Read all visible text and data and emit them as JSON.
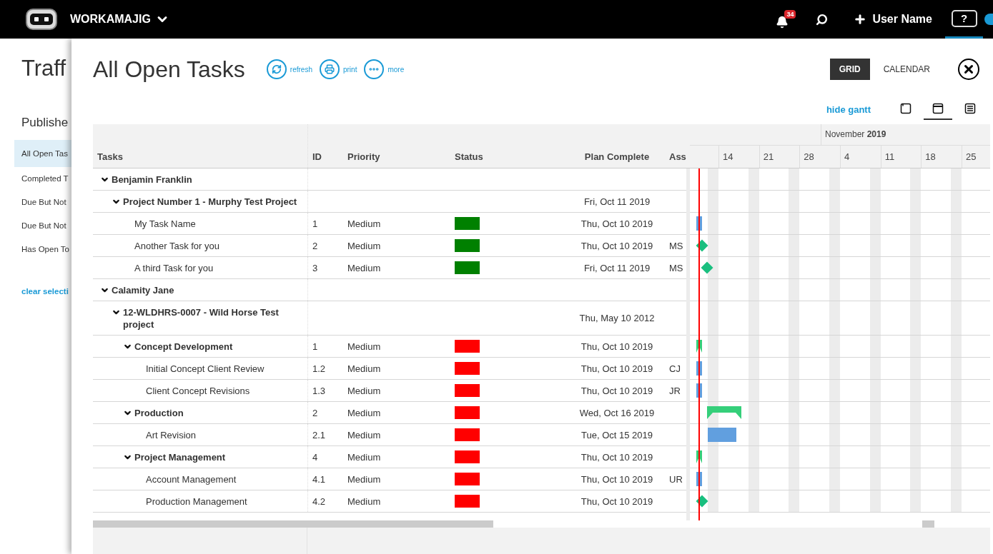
{
  "app": {
    "name": "WORKAMAJIG",
    "notification_count": "34",
    "user_name": "User Name",
    "help_label": "?"
  },
  "background_page": {
    "title": "Traff",
    "section_title": "Publishe",
    "filters": [
      {
        "label": "All Open Tas",
        "selected": true
      },
      {
        "label": "Completed T",
        "selected": false
      },
      {
        "label": "Due But Not",
        "selected": false
      },
      {
        "label": "Due But Not",
        "selected": false
      },
      {
        "label": "Has Open To",
        "selected": false
      }
    ],
    "clear_link": "clear selecti"
  },
  "panel": {
    "title": "All Open Tasks",
    "actions": [
      {
        "kind": "refresh",
        "label": "refresh"
      },
      {
        "kind": "print",
        "label": "print"
      },
      {
        "kind": "more",
        "label": "more"
      }
    ],
    "view_tabs": [
      {
        "label": "GRID",
        "selected": true
      },
      {
        "label": "CALENDAR",
        "selected": false
      }
    ],
    "gantt_toggle": "hide gantt",
    "layout_modes": [
      {
        "kind": "grid-only",
        "selected": false
      },
      {
        "kind": "split",
        "selected": true
      },
      {
        "kind": "list",
        "selected": false
      }
    ]
  },
  "table": {
    "columns": [
      "Tasks",
      "ID",
      "Priority",
      "Status",
      "Plan Complete",
      "Ass"
    ],
    "rows": [
      {
        "task": "Benjamin Franklin",
        "kind": "group",
        "expanded": true,
        "children": [
          {
            "task": "Project Number 1 - Murphy Test Project",
            "kind": "group",
            "expanded": true,
            "plan_complete": "Fri, Oct 11 2019",
            "children": [
              {
                "task": "My Task Name",
                "kind": "task",
                "id": "1",
                "priority": "Medium",
                "color": "#008000",
                "plan_complete": "Thu, Oct 10 2019",
                "bar": {
                  "kind": "task"
                }
              },
              {
                "task": "Another Task for you",
                "kind": "task",
                "id": "2",
                "priority": "Medium",
                "color": "#008000",
                "plan_complete": "Thu, Oct 10 2019",
                "assignee": "MS",
                "bar": {
                  "kind": "milestone"
                }
              },
              {
                "task": "A third Task for you",
                "kind": "task",
                "id": "3",
                "priority": "Medium",
                "color": "#008000",
                "plan_complete": "Fri, Oct 11 2019",
                "assignee": "MS",
                "bar": {
                  "kind": "milestone"
                }
              }
            ]
          }
        ]
      },
      {
        "task": "Calamity Jane",
        "kind": "group",
        "expanded": true,
        "children": [
          {
            "task": "12-WLDHRS-0007 - Wild Horse Test project",
            "kind": "group",
            "expanded": true,
            "plan_complete": "Thu, May 10 2012",
            "children": [
              {
                "task": "Concept Development",
                "kind": "group",
                "expanded": true,
                "id": "1",
                "priority": "Medium",
                "color": "#ff0000",
                "plan_complete": "Thu, Oct 10 2019",
                "bar": {
                  "kind": "summary"
                },
                "children": [
                  {
                    "task": "Initial Concept Client Review",
                    "kind": "task",
                    "id": "1.2",
                    "priority": "Medium",
                    "color": "#ff0000",
                    "plan_complete": "Thu, Oct 10 2019",
                    "assignee": "CJ",
                    "bar": {
                      "kind": "task"
                    }
                  },
                  {
                    "task": "Client Concept Revisions",
                    "kind": "task",
                    "id": "1.3",
                    "priority": "Medium",
                    "color": "#ff0000",
                    "plan_complete": "Thu, Oct 10 2019",
                    "assignee": "JR",
                    "bar": {
                      "kind": "task"
                    }
                  }
                ]
              },
              {
                "task": "Production",
                "kind": "group",
                "expanded": true,
                "id": "2",
                "priority": "Medium",
                "color": "#ff0000",
                "plan_complete": "Wed, Oct 16 2019",
                "bar": {
                  "kind": "summary"
                },
                "children": [
                  {
                    "task": "Art Revision",
                    "kind": "task",
                    "id": "2.1",
                    "priority": "Medium",
                    "color": "#ff0000",
                    "plan_complete": "Tue, Oct 15 2019",
                    "bar": {
                      "kind": "task"
                    }
                  }
                ]
              },
              {
                "task": "Project Management",
                "kind": "group",
                "expanded": true,
                "id": "4",
                "priority": "Medium",
                "color": "#ff0000",
                "plan_complete": "Thu, Oct 10 2019",
                "bar": {
                  "kind": "summary"
                },
                "children": [
                  {
                    "task": "Account Management",
                    "kind": "task",
                    "id": "4.1",
                    "priority": "Medium",
                    "color": "#ff0000",
                    "plan_complete": "Thu, Oct 10 2019",
                    "assignee": "UR",
                    "bar": {
                      "kind": "task"
                    }
                  },
                  {
                    "task": "Production Management",
                    "kind": "task",
                    "id": "4.2",
                    "priority": "Medium",
                    "color": "#ff0000",
                    "plan_complete": "Thu, Oct 10 2019",
                    "bar": {
                      "kind": "milestone"
                    }
                  }
                ]
              }
            ]
          }
        ]
      }
    ]
  },
  "gantt": {
    "months": [
      "November **2019**"
    ],
    "weeks": [
      "14",
      "21",
      "28",
      "4",
      "11",
      "18",
      "25"
    ]
  }
}
